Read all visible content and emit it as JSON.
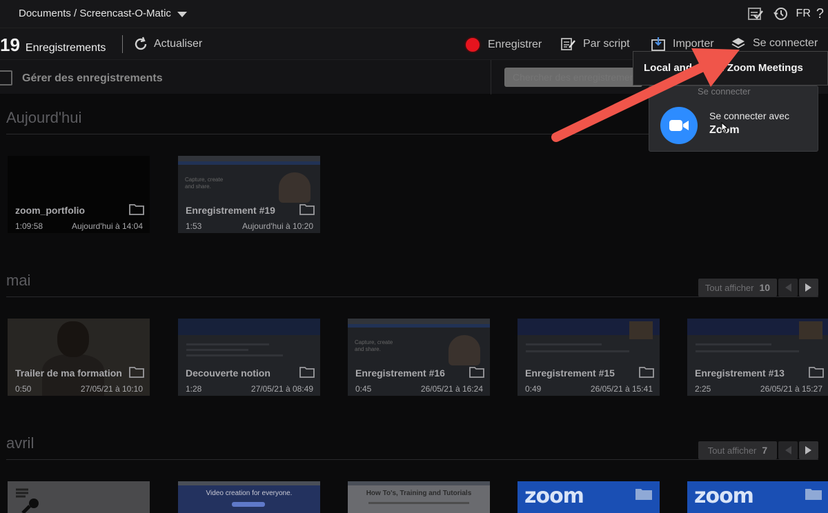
{
  "topbar": {
    "path": "Documents / Screencast-O-Matic",
    "lang": "FR",
    "help": "?"
  },
  "toolbar": {
    "count": "19",
    "count_label": "Enregistrements",
    "refresh": "Actualiser",
    "record": "Enregistrer",
    "script": "Par script",
    "import": "Importer",
    "connect": "Se connecter"
  },
  "manage": {
    "label": "Gérer des enregistrements",
    "search_placeholder": "Chercher des enregistrements"
  },
  "tooltip": "Local and Cloud Zoom Meetings",
  "popover": {
    "subtitle": "Se connecter",
    "line1": "Se connecter avec",
    "line2": "Zoom"
  },
  "sections": [
    {
      "title": "Aujourd'hui",
      "cards": [
        {
          "title": "zoom_portfolio",
          "duration": "1:09:58",
          "date": "Aujourd'hui à 14:04"
        },
        {
          "title": "Enregistrement #19",
          "duration": "1:53",
          "date": "Aujourd'hui à 10:20",
          "thumb_text": "Capture, create and share."
        }
      ]
    },
    {
      "title": "mai",
      "show_all": "Tout afficher",
      "show_all_count": "10",
      "cards": [
        {
          "title": "Trailer de ma formation",
          "duration": "0:50",
          "date": "27/05/21 à 10:10"
        },
        {
          "title": "Decouverte notion",
          "duration": "1:28",
          "date": "27/05/21 à 08:49"
        },
        {
          "title": "Enregistrement #16",
          "duration": "0:45",
          "date": "26/05/21 à 16:24",
          "thumb_text": "Capture, create and share."
        },
        {
          "title": "Enregistrement #15",
          "duration": "0:49",
          "date": "26/05/21 à 15:41"
        },
        {
          "title": "Enregistrement #13",
          "duration": "2:25",
          "date": "26/05/21 à 15:27"
        }
      ]
    },
    {
      "title": "avril",
      "show_all": "Tout afficher",
      "show_all_count": "7",
      "cards": [
        {},
        {
          "thumb_text": "Video creation for everyone."
        },
        {
          "thumb_text": "How To's, Training and Tutorials"
        },
        {
          "thumb_text": "zoom"
        },
        {
          "thumb_text": "zoom"
        }
      ]
    }
  ],
  "colors": {
    "record_red": "#e6141e",
    "zoom_blue": "#2d8cff",
    "arrow": "#f0554a"
  }
}
